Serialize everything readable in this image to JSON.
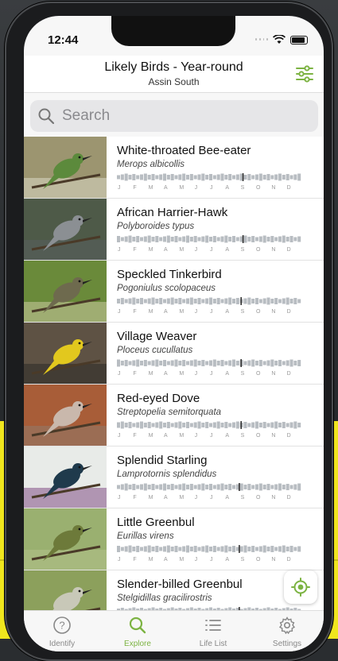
{
  "status": {
    "time": "12:44"
  },
  "header": {
    "title": "Likely Birds - Year-round",
    "subtitle": "Assin South"
  },
  "search": {
    "placeholder": "Search"
  },
  "months": [
    "J",
    "F",
    "M",
    "A",
    "M",
    "J",
    "J",
    "A",
    "S",
    "O",
    "N",
    "D"
  ],
  "birds": [
    {
      "name": "White-throated Bee-eater",
      "scientific": "Merops albicollis"
    },
    {
      "name": "African Harrier-Hawk",
      "scientific": "Polyboroides typus"
    },
    {
      "name": "Speckled Tinkerbird",
      "scientific": "Pogoniulus scolopaceus"
    },
    {
      "name": "Village Weaver",
      "scientific": "Ploceus cucullatus"
    },
    {
      "name": "Red-eyed Dove",
      "scientific": "Streptopelia semitorquata"
    },
    {
      "name": "Splendid Starling",
      "scientific": "Lamprotornis splendidus"
    },
    {
      "name": "Little Greenbul",
      "scientific": "Eurillas virens"
    },
    {
      "name": "Slender-billed Greenbul",
      "scientific": "Stelgidillas gracilirostris"
    }
  ],
  "tabs": [
    {
      "label": "Identify",
      "icon": "question-icon"
    },
    {
      "label": "Explore",
      "icon": "search-icon"
    },
    {
      "label": "Life List",
      "icon": "list-icon"
    },
    {
      "label": "Settings",
      "icon": "gear-icon"
    }
  ],
  "colors": {
    "accent": "#7cb342",
    "bar": "#b8bdc2",
    "marker": "#333333"
  }
}
